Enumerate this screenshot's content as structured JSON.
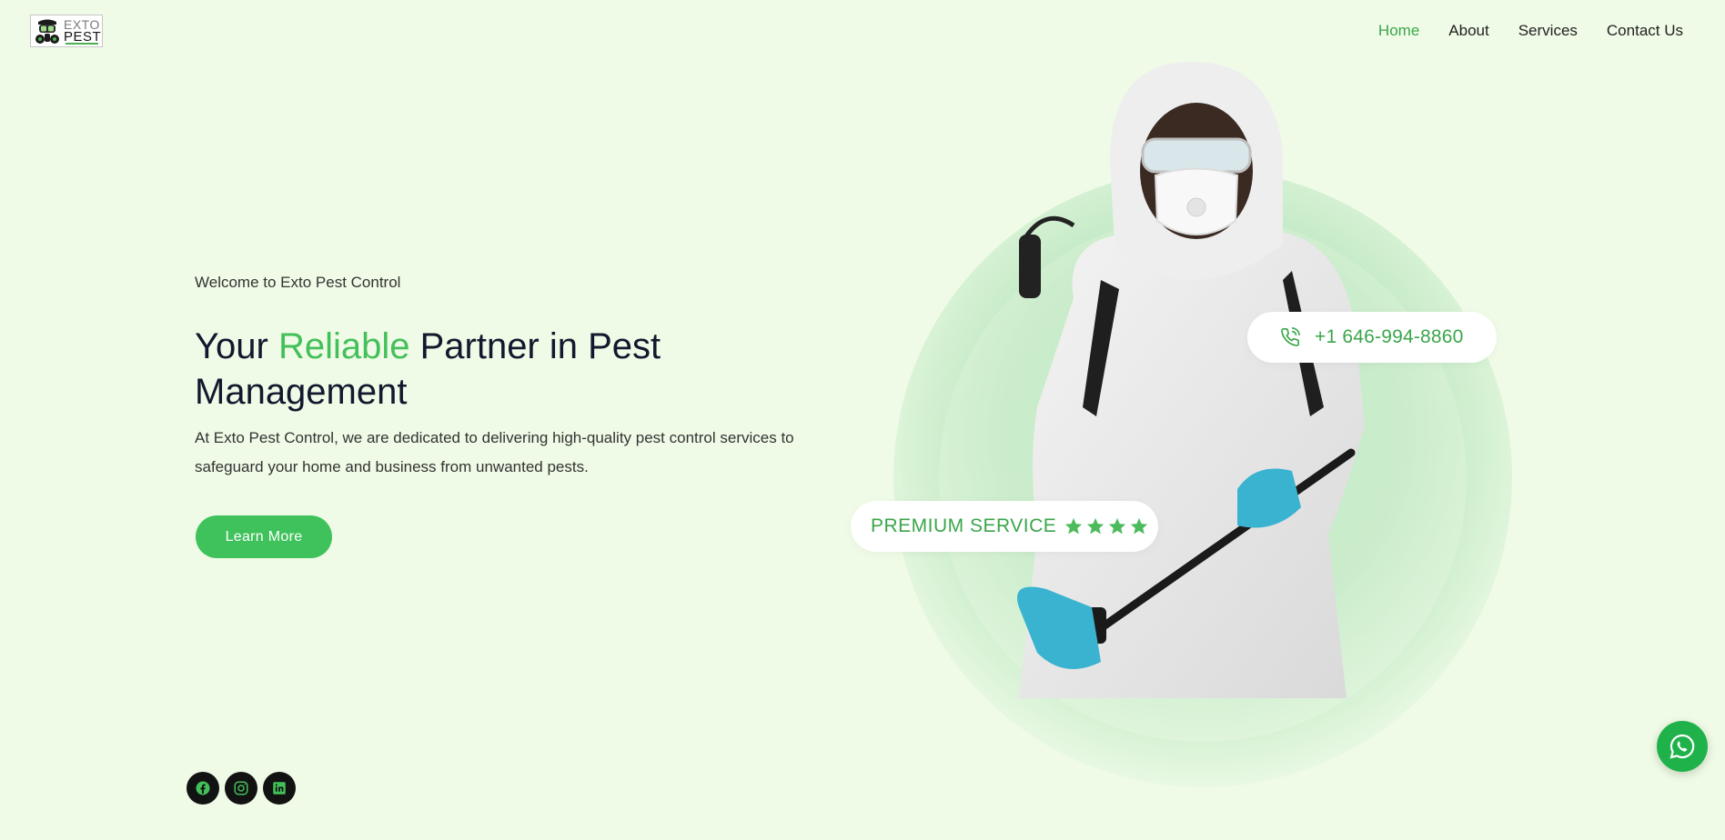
{
  "logo": {
    "line1": "EXTO",
    "line2": "PEST"
  },
  "nav": {
    "items": [
      {
        "label": "Home",
        "active": true
      },
      {
        "label": "About",
        "active": false
      },
      {
        "label": "Services",
        "active": false
      },
      {
        "label": "Contact Us",
        "active": false
      }
    ]
  },
  "hero": {
    "subtitle": "Welcome to Exto Pest Control",
    "title_before": "Your ",
    "title_accent": "Reliable",
    "title_after": " Partner in Pest Management",
    "description": "At Exto Pest Control, we are dedicated to delivering high-quality pest control services to safeguard your home and business from unwanted pests.",
    "cta_label": "Learn More"
  },
  "badges": {
    "phone": "+1 646-994-8860",
    "premium": "PREMIUM SERVICE",
    "star_count": 4
  },
  "social": [
    "facebook-icon",
    "instagram-icon",
    "linkedin-icon"
  ],
  "colors": {
    "accent": "#43c05a",
    "background": "#effbe6",
    "whatsapp": "#20b24a"
  }
}
